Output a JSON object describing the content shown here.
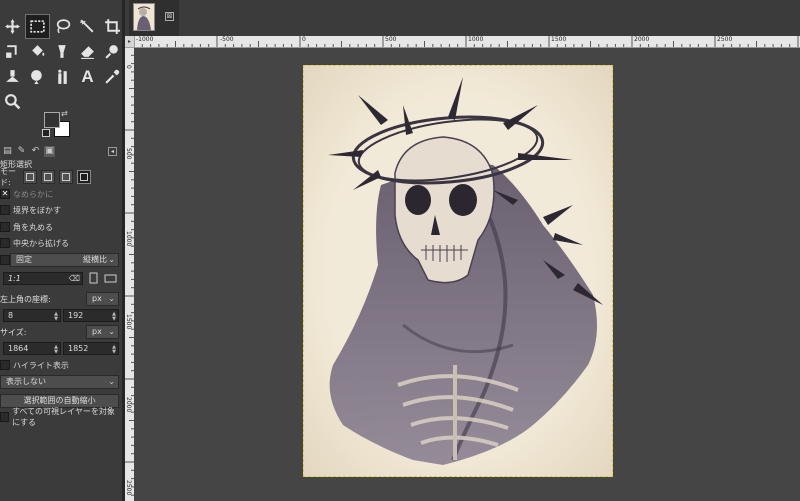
{
  "toolbox": {
    "tools": [
      {
        "name": "move-tool-icon"
      },
      {
        "name": "rect-select-tool-icon",
        "active": true
      },
      {
        "name": "lasso-tool-icon"
      },
      {
        "name": "fuzzy-select-tool-icon"
      },
      {
        "name": "crop-tool-icon"
      },
      {
        "name": "transform-tool-icon"
      },
      {
        "name": "bucket-fill-tool-icon"
      },
      {
        "name": "paint-tool-icon"
      },
      {
        "name": "eraser-tool-icon"
      },
      {
        "name": "heal-tool-icon"
      },
      {
        "name": "clone-tool-icon"
      },
      {
        "name": "smudge-tool-icon"
      },
      {
        "name": "text-tool-icon"
      },
      {
        "name": "color-picker-tool-icon"
      },
      {
        "name": "zoom-tool-icon"
      }
    ],
    "text_tool_glyph": "A"
  },
  "tool_options": {
    "title": "矩形選択",
    "mode_label": "モード:",
    "antialias_label": "なめらかに",
    "feather_label": "境界をぼかす",
    "rounded_label": "角を丸める",
    "expand_center_label": "中央から拡げる",
    "fixed_label": "固定",
    "fixed_type": "縦横比",
    "ratio_value": "1:1",
    "position_label": "左上角の座標:",
    "position_unit": "px",
    "pos_x": "8",
    "pos_y": "192",
    "size_label": "サイズ:",
    "size_unit": "px",
    "size_w": "1864",
    "size_h": "1852",
    "highlight_label": "ハイライト表示",
    "guides_value": "表示しない",
    "autoshrink_label": "選択範囲の自動縮小",
    "sample_merged_label": "すべての可視レイヤーを対象にする"
  },
  "image_tab": {
    "close_glyph": "⊠"
  },
  "ruler": {
    "h_labels": [
      "-1000",
      "-500",
      "0",
      "500",
      "1000",
      "1500",
      "2000",
      "2500"
    ],
    "v_labels": [
      "0",
      "500",
      "1000",
      "1500",
      "2000",
      "2500"
    ]
  },
  "colors": {
    "canvas_bg": "#454545",
    "panel_bg": "#3b3b3b",
    "paper": "#efe7d6",
    "ink": "#4a4152",
    "selection": "#e0c84a"
  }
}
